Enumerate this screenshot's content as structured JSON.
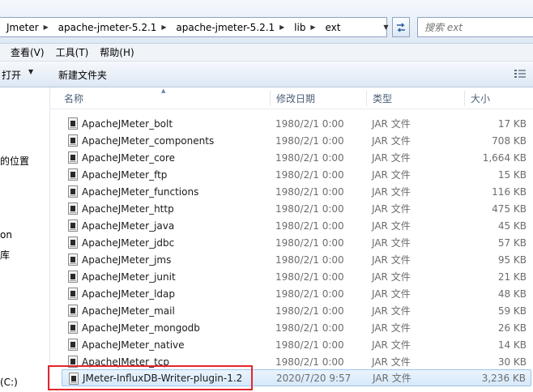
{
  "address": {
    "breadcrumbs": [
      "Jmeter",
      "apache-jmeter-5.2.1",
      "apache-jmeter-5.2.1",
      "lib",
      "ext"
    ],
    "search_placeholder": "搜索 ext"
  },
  "menu": {
    "items": [
      "查看(V)",
      "工具(T)",
      "帮助(H)"
    ]
  },
  "toolbar": {
    "open_label": "打开",
    "new_folder_label": "新建文件夹"
  },
  "nav": {
    "fragments": [
      "的位置",
      "on",
      "库",
      "(C:)"
    ]
  },
  "columns": {
    "name": "名称",
    "date": "修改日期",
    "type": "类型",
    "size": "大小"
  },
  "files": [
    {
      "name": "ApacheJMeter_bolt",
      "date": "1980/2/1 0:00",
      "type": "JAR 文件",
      "size": "17 KB"
    },
    {
      "name": "ApacheJMeter_components",
      "date": "1980/2/1 0:00",
      "type": "JAR 文件",
      "size": "708 KB"
    },
    {
      "name": "ApacheJMeter_core",
      "date": "1980/2/1 0:00",
      "type": "JAR 文件",
      "size": "1,664 KB"
    },
    {
      "name": "ApacheJMeter_ftp",
      "date": "1980/2/1 0:00",
      "type": "JAR 文件",
      "size": "15 KB"
    },
    {
      "name": "ApacheJMeter_functions",
      "date": "1980/2/1 0:00",
      "type": "JAR 文件",
      "size": "116 KB"
    },
    {
      "name": "ApacheJMeter_http",
      "date": "1980/2/1 0:00",
      "type": "JAR 文件",
      "size": "475 KB"
    },
    {
      "name": "ApacheJMeter_java",
      "date": "1980/2/1 0:00",
      "type": "JAR 文件",
      "size": "45 KB"
    },
    {
      "name": "ApacheJMeter_jdbc",
      "date": "1980/2/1 0:00",
      "type": "JAR 文件",
      "size": "57 KB"
    },
    {
      "name": "ApacheJMeter_jms",
      "date": "1980/2/1 0:00",
      "type": "JAR 文件",
      "size": "95 KB"
    },
    {
      "name": "ApacheJMeter_junit",
      "date": "1980/2/1 0:00",
      "type": "JAR 文件",
      "size": "21 KB"
    },
    {
      "name": "ApacheJMeter_ldap",
      "date": "1980/2/1 0:00",
      "type": "JAR 文件",
      "size": "48 KB"
    },
    {
      "name": "ApacheJMeter_mail",
      "date": "1980/2/1 0:00",
      "type": "JAR 文件",
      "size": "59 KB"
    },
    {
      "name": "ApacheJMeter_mongodb",
      "date": "1980/2/1 0:00",
      "type": "JAR 文件",
      "size": "26 KB"
    },
    {
      "name": "ApacheJMeter_native",
      "date": "1980/2/1 0:00",
      "type": "JAR 文件",
      "size": "14 KB"
    },
    {
      "name": "ApacheJMeter_tcp",
      "date": "1980/2/1 0:00",
      "type": "JAR 文件",
      "size": "30 KB"
    },
    {
      "name": "JMeter-InfluxDB-Writer-plugin-1.2",
      "date": "2020/7/20 9:57",
      "type": "JAR 文件",
      "size": "3,236 KB"
    }
  ],
  "selected_file": "JMeter-InfluxDB-Writer-plugin-1.2",
  "colors": {
    "highlight_border": "#e3262c",
    "selection_bg": "#d7e9fb"
  }
}
